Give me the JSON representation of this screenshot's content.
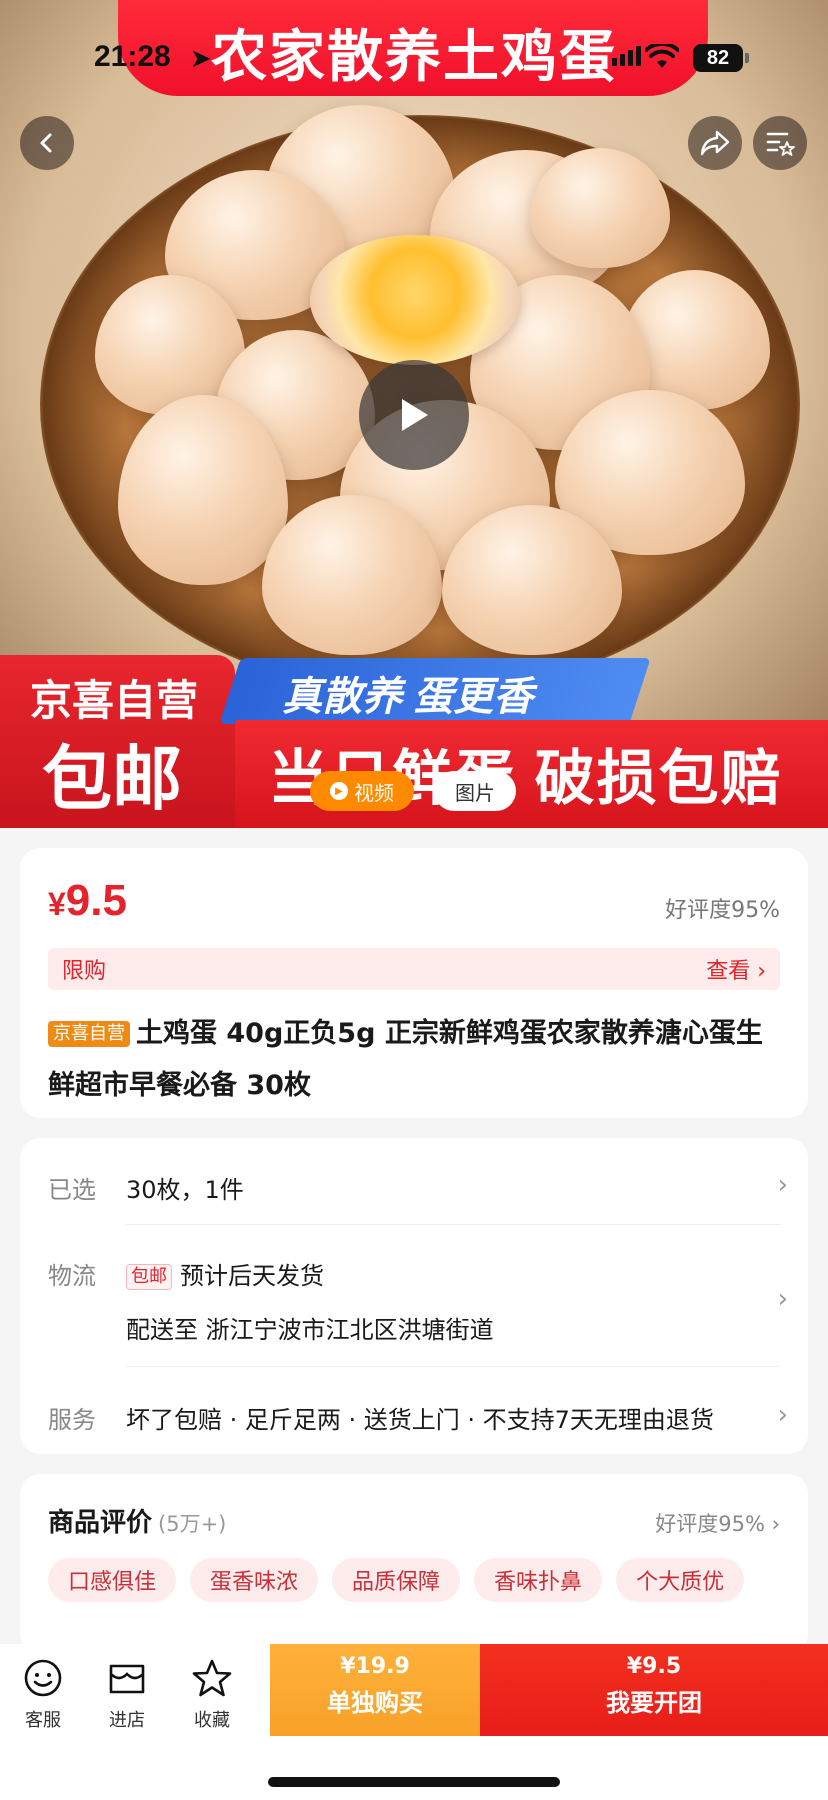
{
  "status_bar": {
    "time": "21:28",
    "battery": "82"
  },
  "hero": {
    "banner": "农家散养土鸡蛋",
    "store_badge": "京喜自营",
    "shipping_badge": "包邮",
    "slogan": "真散养 蛋更香",
    "strip_text": "当日鲜蛋 破损包赔",
    "tabs": {
      "video": "视频",
      "photo": "图片"
    }
  },
  "product": {
    "price_symbol": "¥",
    "price": "9.5",
    "rating": "好评度95%",
    "limit_label": "限购",
    "limit_action": "查看 ›",
    "store_tag": "京喜自营",
    "title": "土鸡蛋 40g正负5g 正宗新鲜鸡蛋农家散养溏心蛋生鲜超市早餐必备 30枚"
  },
  "options": {
    "selected_label": "已选",
    "selected_value": "30枚，1件",
    "logistics_label": "物流",
    "free_tag": "包邮",
    "logistics_value": "预计后天发货",
    "delivery": "配送至 浙江宁波市江北区洪塘街道",
    "service_label": "服务",
    "service_value": "坏了包赔 · 足斤足两 · 送货上门 · 不支持7天无理由退货"
  },
  "reviews": {
    "title": "商品评价",
    "count": "(5万+)",
    "rating": "好评度95% ›",
    "tags": [
      "口感俱佳",
      "蛋香味浓",
      "品质保障",
      "香味扑鼻",
      "个大质优"
    ]
  },
  "bottom_bar": {
    "service": "客服",
    "store": "进店",
    "favorite": "收藏",
    "solo_price": "¥19.9",
    "solo_label": "单独购买",
    "group_price": "¥9.5",
    "group_label": "我要开团"
  },
  "colors": {
    "accent_red": "#e4232d",
    "orange": "#f7a128"
  }
}
